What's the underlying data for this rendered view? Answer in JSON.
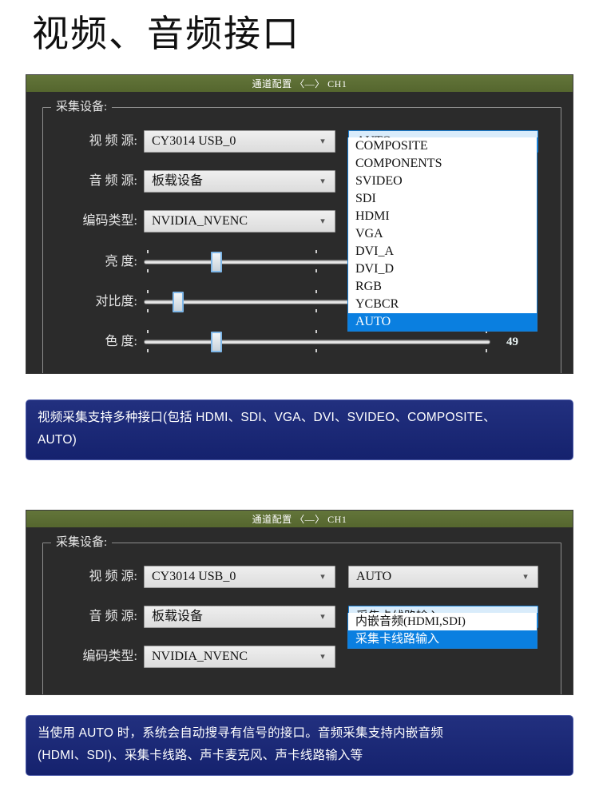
{
  "heading": "视频、音频接口",
  "dialog1": {
    "title": "通道配置 〈—〉 CH1",
    "groupbox_legend": "采集设备:",
    "rows": [
      {
        "label": "视 频 源:",
        "left_value": "CY3014 USB_0",
        "right_value": "AUTO"
      },
      {
        "label": "音 频 源:",
        "left_value": "板载设备"
      },
      {
        "label": "编码类型:",
        "left_value": "NVIDIA_NVENC"
      }
    ],
    "open_dropdown": {
      "options": [
        "COMPOSITE",
        "COMPONENTS",
        "SVIDEO",
        "SDI",
        "HDMI",
        "VGA",
        "DVI_A",
        "DVI_D",
        "RGB",
        "YCBCR",
        "AUTO"
      ],
      "selected": "AUTO"
    },
    "sliders": [
      {
        "label": "亮 度:",
        "value": "",
        "position": 21
      },
      {
        "label": "对比度:",
        "value": "",
        "position": 9
      },
      {
        "label": "色 度:",
        "value": "49",
        "position": 21
      }
    ]
  },
  "caption1": {
    "line1": "视频采集支持多种接口(包括 HDMI、SDI、VGA、DVI、SVIDEO、COMPOSITE、",
    "line2": "AUTO)"
  },
  "dialog2": {
    "title": "通道配置 〈—〉 CH1",
    "groupbox_legend": "采集设备:",
    "rows": [
      {
        "label": "视 频 源:",
        "left_value": "CY3014 USB_0",
        "right_value": "AUTO"
      },
      {
        "label": "音 频 源:",
        "left_value": "板载设备",
        "right_value": "采集卡线路输入"
      },
      {
        "label": "编码类型:",
        "left_value": "NVIDIA_NVENC"
      }
    ],
    "open_dropdown": {
      "options": [
        "内嵌音频(HDMI,SDI)",
        "采集卡线路输入"
      ],
      "selected": "采集卡线路输入"
    }
  },
  "caption2": {
    "line1": "当使用 AUTO 时，系统会自动搜寻有信号的接口。音频采集支持内嵌音频",
    "line2": "(HDMI、SDI)、采集卡线路、声卡麦克风、声卡线路输入等"
  },
  "colors": {
    "titlebar": "#5d6f33",
    "dialog_bg": "#2b2b2b",
    "caption_bg": "#1b2a7d",
    "highlight": "#0a7fe0",
    "focus_field": "#d9ecfb"
  }
}
